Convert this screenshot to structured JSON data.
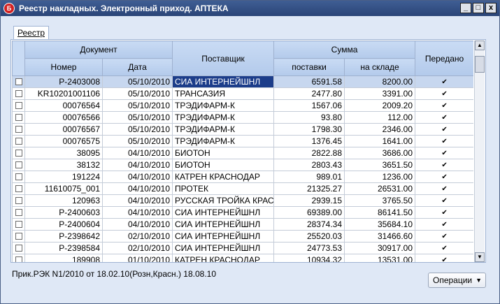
{
  "window": {
    "title": "Реестр накладных. Электронный приход.  АПТЕКА",
    "icon": "app-logo-icon",
    "controls": [
      "_",
      "□",
      "x"
    ]
  },
  "tab": {
    "label": "Реестр"
  },
  "grid": {
    "headers": {
      "document": "Документ",
      "number": "Номер",
      "date": "Дата",
      "supplier": "Поставщик",
      "sum": "Сумма",
      "delivery": "поставки",
      "stock": "на складе",
      "transferred": "Передано"
    },
    "rows": [
      {
        "number": "Р-2403008",
        "date": "05/10/2010",
        "supplier": "СИА ИНТЕРНЕЙШНЛ",
        "delivery": "6591.58",
        "stock": "8200.00",
        "transferred": true
      },
      {
        "number": "KR10201001106",
        "date": "05/10/2010",
        "supplier": "ТРАНСАЗИЯ",
        "delivery": "2477.80",
        "stock": "3391.00",
        "transferred": true
      },
      {
        "number": "00076564",
        "date": "05/10/2010",
        "supplier": "ТРЭДИФАРМ-К",
        "delivery": "1567.06",
        "stock": "2009.20",
        "transferred": true
      },
      {
        "number": "00076566",
        "date": "05/10/2010",
        "supplier": "ТРЭДИФАРМ-К",
        "delivery": "93.80",
        "stock": "112.00",
        "transferred": true
      },
      {
        "number": "00076567",
        "date": "05/10/2010",
        "supplier": "ТРЭДИФАРМ-К",
        "delivery": "1798.30",
        "stock": "2346.00",
        "transferred": true
      },
      {
        "number": "00076575",
        "date": "05/10/2010",
        "supplier": "ТРЭДИФАРМ-К",
        "delivery": "1376.45",
        "stock": "1641.00",
        "transferred": true
      },
      {
        "number": "38095",
        "date": "04/10/2010",
        "supplier": "БИОТОН",
        "delivery": "2822.88",
        "stock": "3686.00",
        "transferred": true
      },
      {
        "number": "38132",
        "date": "04/10/2010",
        "supplier": "БИОТОН",
        "delivery": "2803.43",
        "stock": "3651.50",
        "transferred": true
      },
      {
        "number": "191224",
        "date": "04/10/2010",
        "supplier": "КАТРЕН КРАСНОДАР",
        "delivery": "989.01",
        "stock": "1236.00",
        "transferred": true
      },
      {
        "number": "11610075_001",
        "date": "04/10/2010",
        "supplier": "ПРОТЕК",
        "delivery": "21325.27",
        "stock": "26531.00",
        "transferred": true
      },
      {
        "number": "120963",
        "date": "04/10/2010",
        "supplier": "РУССКАЯ ТРОЙКА КРАС",
        "delivery": "2939.15",
        "stock": "3765.50",
        "transferred": true
      },
      {
        "number": "Р-2400603",
        "date": "04/10/2010",
        "supplier": "СИА ИНТЕРНЕЙШНЛ",
        "delivery": "69389.00",
        "stock": "86141.50",
        "transferred": true
      },
      {
        "number": "Р-2400604",
        "date": "04/10/2010",
        "supplier": "СИА ИНТЕРНЕЙШНЛ",
        "delivery": "28374.34",
        "stock": "35684.10",
        "transferred": true
      },
      {
        "number": "Р-2398642",
        "date": "02/10/2010",
        "supplier": "СИА ИНТЕРНЕЙШНЛ",
        "delivery": "25520.03",
        "stock": "31466.60",
        "transferred": true
      },
      {
        "number": "Р-2398584",
        "date": "02/10/2010",
        "supplier": "СИА ИНТЕРНЕЙШНЛ",
        "delivery": "24773.53",
        "stock": "30917.00",
        "transferred": true
      },
      {
        "number": "189908",
        "date": "01/10/2010",
        "supplier": "КАТРЕН КРАСНОДАР",
        "delivery": "10934.32",
        "stock": "13531.00",
        "transferred": true
      }
    ],
    "active_row": 0
  },
  "status": {
    "text": "Прик.РЭК N1/2010 от 18.02.10(Розн,Красн.) 18.08.10"
  },
  "operations_button": {
    "label": "Операции"
  },
  "colors": {
    "title_bar": "#2a4477",
    "header": "#c9dbf4",
    "selection": "#1c3d8a"
  }
}
